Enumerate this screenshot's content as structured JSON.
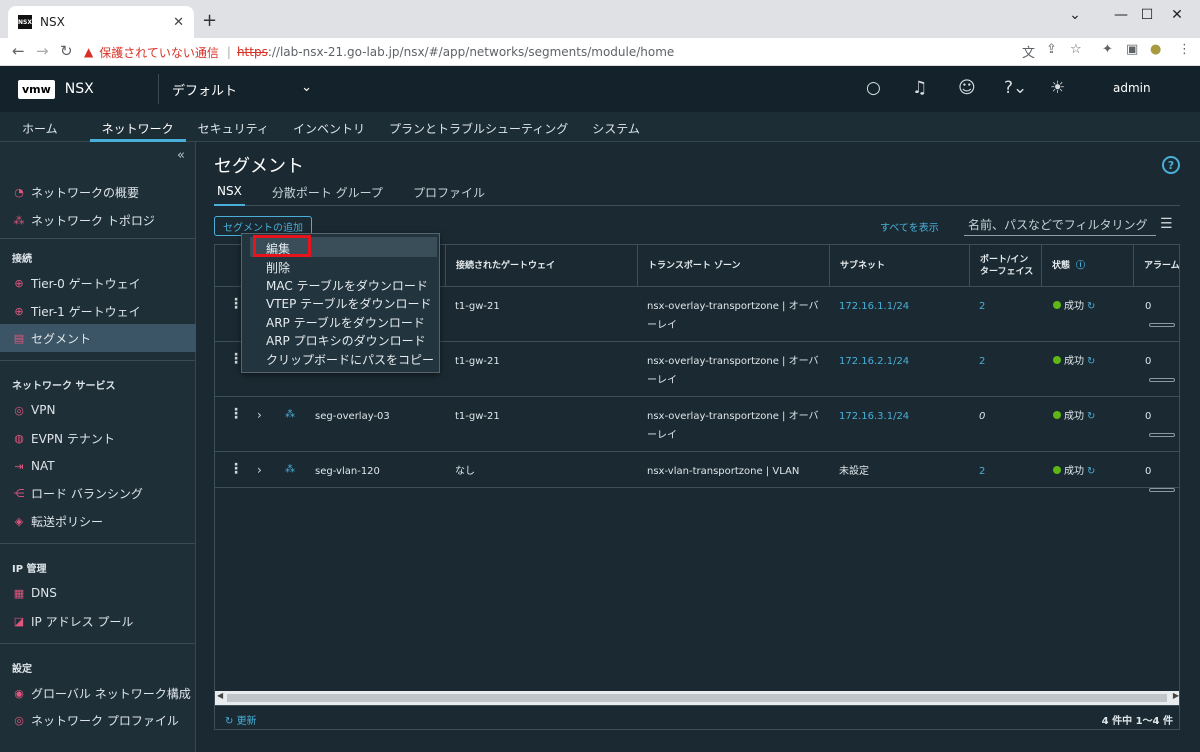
{
  "browser": {
    "tab_title": "NSX",
    "tab_favicon": "NSX",
    "warning_text": "保護されていない通信",
    "url_scheme": "https",
    "url_rest": "://lab-nsx-21.go-lab.jp/nsx/#/app/networks/segments/module/home"
  },
  "header": {
    "logo": "vmw",
    "app_name": "NSX",
    "project": "デフォルト",
    "user": "admin"
  },
  "nav": [
    "ホーム",
    "ネットワーク",
    "セキュリティ",
    "インベントリ",
    "プランとトラブルシューティング",
    "システム"
  ],
  "sidebar": {
    "items_top": [
      "ネットワークの概要",
      "ネットワーク トポロジ"
    ],
    "section_connect": "接続",
    "connect_items": [
      "Tier-0 ゲートウェイ",
      "Tier-1 ゲートウェイ",
      "セグメント"
    ],
    "section_services": "ネットワーク サービス",
    "service_items": [
      "VPN",
      "EVPN テナント",
      "NAT",
      "ロード バランシング",
      "転送ポリシー"
    ],
    "section_ip": "IP 管理",
    "ip_items": [
      "DNS",
      "IP アドレス プール"
    ],
    "section_settings": "設定",
    "settings_items": [
      "グローバル ネットワーク構成",
      "ネットワーク プロファイル"
    ]
  },
  "page": {
    "title": "セグメント",
    "tabs": [
      "NSX",
      "分散ポート グループ",
      "プロファイル"
    ],
    "add_button": "セグメントの追加",
    "show_all": "すべてを表示",
    "filter_placeholder": "名前、パスなどでフィルタリング"
  },
  "table": {
    "headers": {
      "gateway": "接続されたゲートウェイ",
      "tz": "トランスポート ゾーン",
      "subnet": "サブネット",
      "ports_l1": "ポート/イン",
      "ports_l2": "ターフェイス",
      "status": "状態",
      "alarm": "アラーム"
    },
    "rows": [
      {
        "name": "",
        "gateway": "t1-gw-21",
        "tz1": "nsx-overlay-transportzone | オーバ",
        "tz2": "ーレイ",
        "subnet": "172.16.1.1/24",
        "ports": "2",
        "status": "成功",
        "alarms": "0"
      },
      {
        "name": "",
        "gateway": "t1-gw-21",
        "tz1": "nsx-overlay-transportzone | オーバ",
        "tz2": "ーレイ",
        "subnet": "172.16.2.1/24",
        "ports": "2",
        "status": "成功",
        "alarms": "0"
      },
      {
        "name": "seg-overlay-03",
        "gateway": "t1-gw-21",
        "tz1": "nsx-overlay-transportzone | オーバ",
        "tz2": "ーレイ",
        "subnet": "172.16.3.1/24",
        "ports": "0",
        "status": "成功",
        "alarms": "0"
      },
      {
        "name": "seg-vlan-120",
        "gateway": "なし",
        "tz1": "nsx-vlan-transportzone | VLAN",
        "tz2": "",
        "subnet": "未設定",
        "ports": "2",
        "status": "成功",
        "alarms": "0"
      }
    ],
    "refresh": "更新",
    "count": "4 件中 1～4 件"
  },
  "context_menu": [
    "編集",
    "削除",
    "MAC テーブルをダウンロード",
    "VTEP テーブルをダウンロード",
    "ARP テーブルをダウンロード",
    "ARP プロキシのダウンロード",
    "クリップボードにパスをコピー"
  ],
  "colors": {
    "accent": "#49afd9",
    "success": "#5eb715",
    "highlight": "#e8141d"
  }
}
